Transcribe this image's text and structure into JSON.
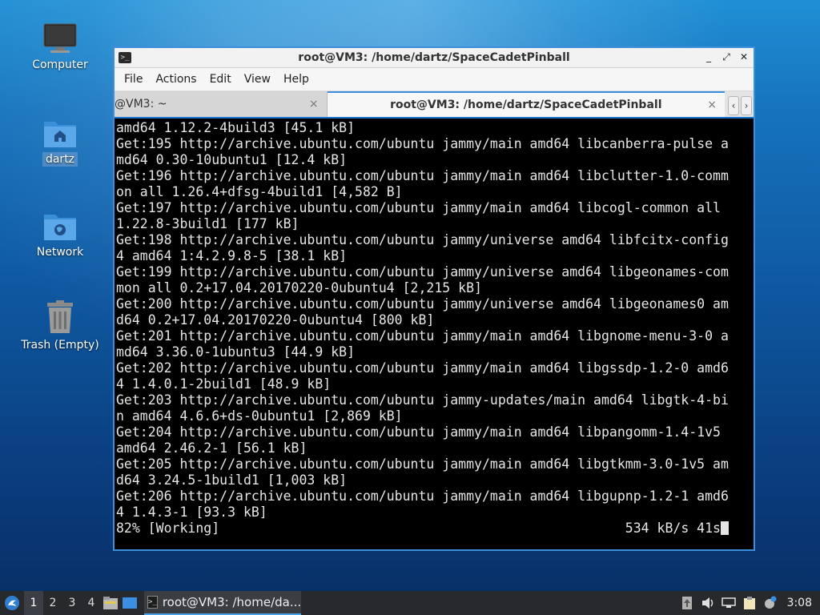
{
  "desktop": {
    "icons": [
      {
        "label": "Computer",
        "icon": "computer-icon"
      },
      {
        "label": "dartz",
        "icon": "home-folder-icon"
      },
      {
        "label": "Network",
        "icon": "network-folder-icon"
      },
      {
        "label": "Trash (Empty)",
        "icon": "trash-icon"
      }
    ]
  },
  "window": {
    "title": "root@VM3: /home/dartz/SpaceCadetPinball",
    "menu": [
      "File",
      "Actions",
      "Edit",
      "View",
      "Help"
    ],
    "tabs": [
      {
        "label": "@VM3: ~",
        "close": "×"
      },
      {
        "label": "root@VM3: /home/dartz/SpaceCadetPinball",
        "close": "×"
      }
    ],
    "buttons": {
      "minimize": "_",
      "maximize": "⤢",
      "close": "✕",
      "tab_prev": "‹",
      "tab_next": "›"
    }
  },
  "terminal": {
    "lines": [
      "amd64 1.12.2-4build3 [45.1 kB]",
      "Get:195 http://archive.ubuntu.com/ubuntu jammy/main amd64 libcanberra-pulse a",
      "md64 0.30-10ubuntu1 [12.4 kB]",
      "Get:196 http://archive.ubuntu.com/ubuntu jammy/main amd64 libclutter-1.0-comm",
      "on all 1.26.4+dfsg-4build1 [4,582 B]",
      "Get:197 http://archive.ubuntu.com/ubuntu jammy/main amd64 libcogl-common all",
      "1.22.8-3build1 [177 kB]",
      "Get:198 http://archive.ubuntu.com/ubuntu jammy/universe amd64 libfcitx-config",
      "4 amd64 1:4.2.9.8-5 [38.1 kB]",
      "Get:199 http://archive.ubuntu.com/ubuntu jammy/universe amd64 libgeonames-com",
      "mon all 0.2+17.04.20170220-0ubuntu4 [2,215 kB]",
      "Get:200 http://archive.ubuntu.com/ubuntu jammy/universe amd64 libgeonames0 am",
      "d64 0.2+17.04.20170220-0ubuntu4 [800 kB]",
      "Get:201 http://archive.ubuntu.com/ubuntu jammy/main amd64 libgnome-menu-3-0 a",
      "md64 3.36.0-1ubuntu3 [44.9 kB]",
      "Get:202 http://archive.ubuntu.com/ubuntu jammy/main amd64 libgssdp-1.2-0 amd6",
      "4 1.4.0.1-2build1 [48.9 kB]",
      "Get:203 http://archive.ubuntu.com/ubuntu jammy-updates/main amd64 libgtk-4-bi",
      "n amd64 4.6.6+ds-0ubuntu1 [2,869 kB]",
      "Get:204 http://archive.ubuntu.com/ubuntu jammy/main amd64 libpangomm-1.4-1v5",
      "amd64 2.46.2-1 [56.1 kB]",
      "Get:205 http://archive.ubuntu.com/ubuntu jammy/main amd64 libgtkmm-3.0-1v5 am",
      "d64 3.24.5-1build1 [1,003 kB]",
      "Get:206 http://archive.ubuntu.com/ubuntu jammy/main amd64 libgupnp-1.2-1 amd6",
      "4 1.4.3-1 [93.3 kB]"
    ],
    "status_left": "82% [Working]",
    "status_right": "534 kB/s 41s"
  },
  "taskbar": {
    "workspaces": [
      "1",
      "2",
      "3",
      "4"
    ],
    "active_workspace": "1",
    "task_label": "root@VM3: /home/da...",
    "clock": "3:08",
    "colors": {
      "accent": "#4aa0e6",
      "bar": "#27292d"
    }
  }
}
